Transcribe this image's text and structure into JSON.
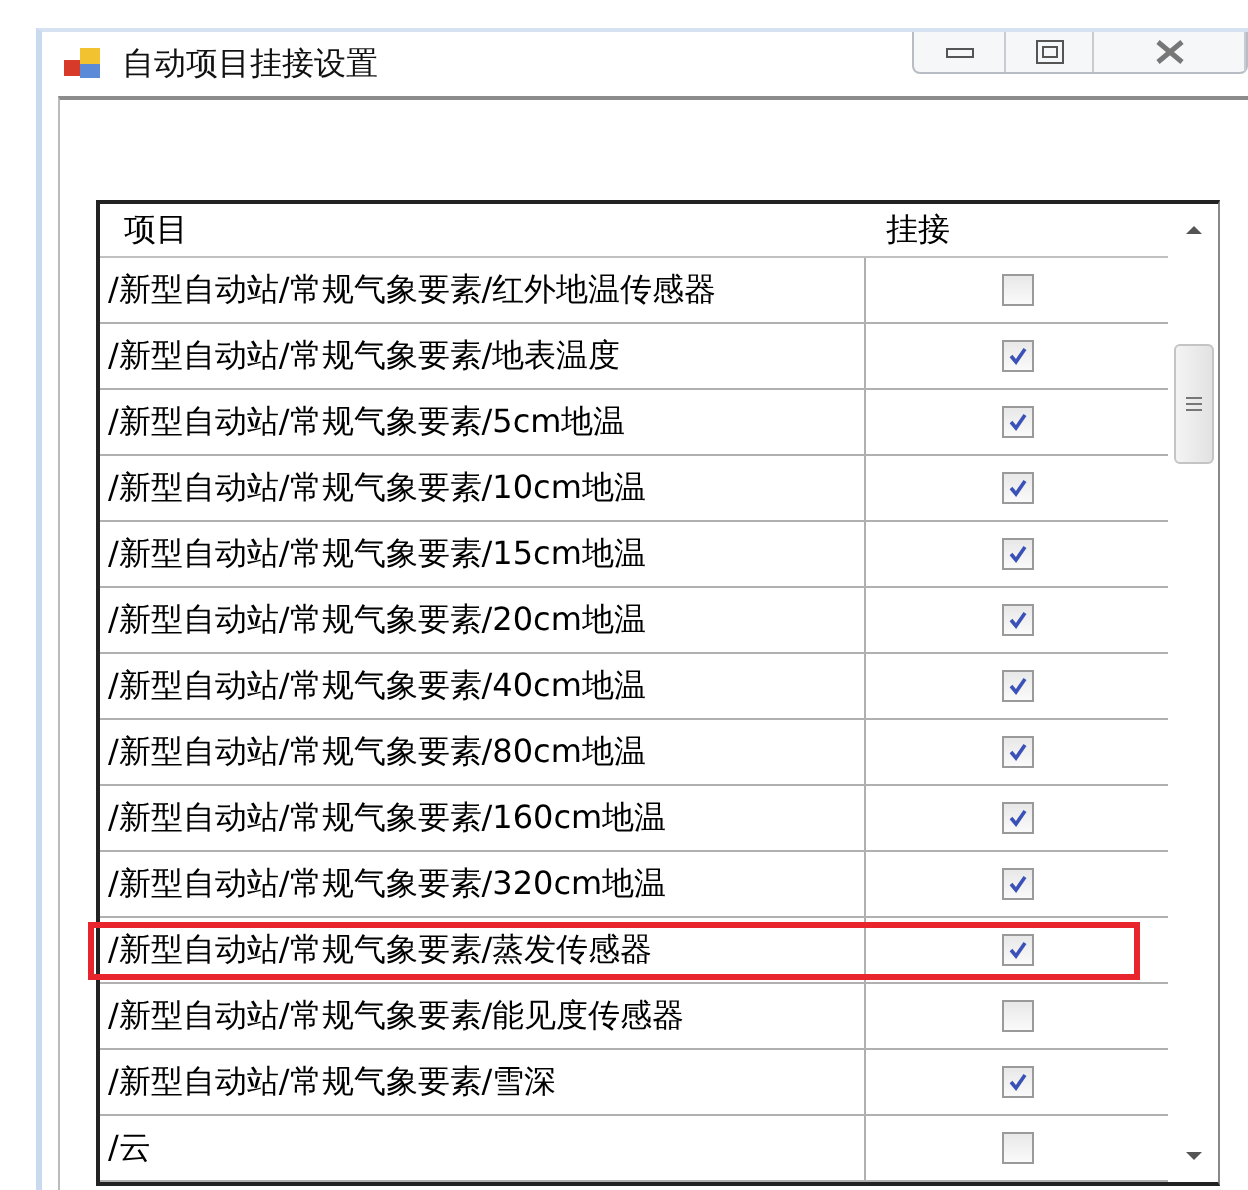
{
  "window": {
    "title": "自动项目挂接设置"
  },
  "table": {
    "columns": [
      "项目",
      "挂接"
    ],
    "rows": [
      {
        "item": "/新型自动站/常规气象要素/红外地温传感器",
        "checked": false,
        "highlighted": false
      },
      {
        "item": "/新型自动站/常规气象要素/地表温度",
        "checked": true,
        "highlighted": false
      },
      {
        "item": "/新型自动站/常规气象要素/5cm地温",
        "checked": true,
        "highlighted": false
      },
      {
        "item": "/新型自动站/常规气象要素/10cm地温",
        "checked": true,
        "highlighted": false
      },
      {
        "item": "/新型自动站/常规气象要素/15cm地温",
        "checked": true,
        "highlighted": false
      },
      {
        "item": "/新型自动站/常规气象要素/20cm地温",
        "checked": true,
        "highlighted": false
      },
      {
        "item": "/新型自动站/常规气象要素/40cm地温",
        "checked": true,
        "highlighted": false
      },
      {
        "item": "/新型自动站/常规气象要素/80cm地温",
        "checked": true,
        "highlighted": false
      },
      {
        "item": "/新型自动站/常规气象要素/160cm地温",
        "checked": true,
        "highlighted": false
      },
      {
        "item": "/新型自动站/常规气象要素/320cm地温",
        "checked": true,
        "highlighted": false
      },
      {
        "item": "/新型自动站/常规气象要素/蒸发传感器",
        "checked": true,
        "highlighted": true
      },
      {
        "item": "/新型自动站/常规气象要素/能见度传感器",
        "checked": false,
        "highlighted": false
      },
      {
        "item": "/新型自动站/常规气象要素/雪深",
        "checked": true,
        "highlighted": false
      },
      {
        "item": "/云",
        "checked": false,
        "highlighted": false
      }
    ]
  }
}
